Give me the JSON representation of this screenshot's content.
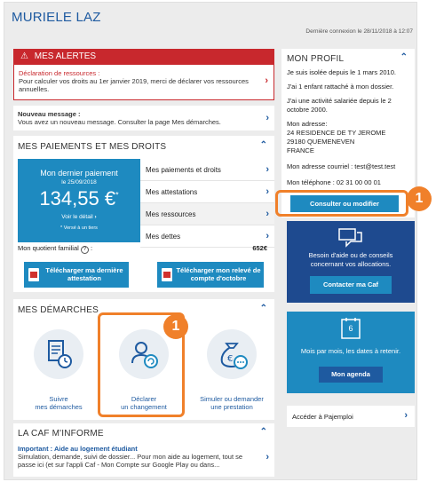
{
  "header": {
    "user_name": "MURIELE LAZ",
    "last_login": "Dernière connexion le 28/11/2018 à 12:07"
  },
  "alerts": {
    "title": "MES ALERTES",
    "item_title": "Déclaration de ressources :",
    "item_text": "Pour calculer vos droits au 1er janvier 2019, merci de déclarer vos ressources annuelles."
  },
  "message": {
    "title": "Nouveau message :",
    "text": "Vous avez un nouveau message. Consulter la page Mes démarches."
  },
  "payments": {
    "title": "MES PAIEMENTS ET MES DROITS",
    "tile_label": "Mon dernier paiement",
    "tile_date": "le 25/09/2018",
    "amount": "134,55 €",
    "amount_mark": "*",
    "detail": "Voir le détail",
    "note": "* Versé à un tiers",
    "menu": [
      "Mes paiements et droits",
      "Mes attestations",
      "Mes ressources",
      "Mes dettes"
    ],
    "quotient_label": "Mon quotient familial",
    "quotient_value": "652€",
    "dl1": "Télécharger ma dernière attestation",
    "dl2": "Télécharger mon relevé de compte d'octobre"
  },
  "demarches": {
    "title": "MES DÉMARCHES",
    "items": [
      {
        "label_line1": "Suivre",
        "label_line2": "mes démarches"
      },
      {
        "label_line1": "Déclarer",
        "label_line2": "un changement"
      },
      {
        "label_line1": "Simuler ou demander",
        "label_line2": "une prestation"
      }
    ]
  },
  "caf_info": {
    "title": "LA CAF M'INFORME",
    "item_title": "Important : Aide au logement étudiant",
    "item_text": "Simulation, demande, suivi de dossier... Pour mon aide au logement, tout se passe ici (et sur l'appli Caf - Mon Compte sur Google Play ou dans..."
  },
  "profile": {
    "title": "MON PROFIL",
    "lines": [
      "Je suis isolée depuis le 1 mars 2010.",
      "J'ai 1 enfant rattaché à mon dossier.",
      "J'ai une activité salariée depuis le 2 octobre 2000.",
      "Mon adresse:",
      "24 RESIDENCE DE TY JEROME",
      "29180 QUEMENEVEN",
      "FRANCE",
      "Mon adresse courriel : test@test.test",
      "Mon téléphone : 02 31 00 00 01"
    ],
    "button": "Consulter ou modifier"
  },
  "help": {
    "text": "Besoin d'aide ou de conseils concernant vos allocations.",
    "button": "Contacter ma Caf"
  },
  "agenda": {
    "calendar_day": "6",
    "text": "Mois par mois, les dates à retenir.",
    "button": "Mon agenda"
  },
  "pajemploi": {
    "label": "Accéder à Pajemploi"
  },
  "annotations": {
    "badge_profile": "1",
    "badge_demarche": "1"
  },
  "colors": {
    "brand_blue": "#1e5aa0",
    "light_blue": "#1e8ac0",
    "alert_red": "#c8282d",
    "highlight_orange": "#f0802a"
  }
}
